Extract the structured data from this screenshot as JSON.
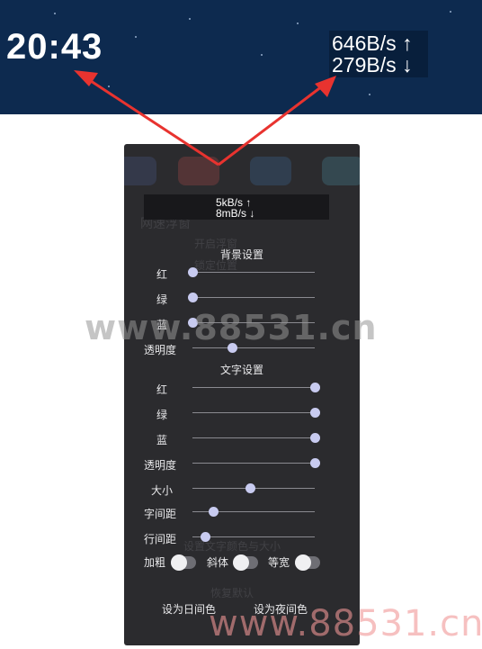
{
  "status_bar": {
    "clock": "20:43",
    "upload_speed": "646B/s ↑",
    "download_speed": "279B/s ↓"
  },
  "preview": {
    "upload": "5kB/s ↑",
    "download": "8mB/s ↓"
  },
  "background_settings": {
    "title": "背景设置",
    "sliders": [
      {
        "label": "红",
        "value": 0.0
      },
      {
        "label": "绿",
        "value": 0.0
      },
      {
        "label": "蓝",
        "value": 0.0
      },
      {
        "label": "透明度",
        "value": 0.32
      }
    ]
  },
  "text_settings": {
    "title": "文字设置",
    "sliders": [
      {
        "label": "红",
        "value": 1.0
      },
      {
        "label": "绿",
        "value": 1.0
      },
      {
        "label": "蓝",
        "value": 1.0
      },
      {
        "label": "透明度",
        "value": 1.0
      },
      {
        "label": "大小",
        "value": 0.47
      },
      {
        "label": "字间距",
        "value": 0.17
      },
      {
        "label": "行间距",
        "value": 0.1
      }
    ]
  },
  "toggles": [
    {
      "label": "加粗",
      "on": false
    },
    {
      "label": "斜体",
      "on": false
    },
    {
      "label": "等宽",
      "on": false
    }
  ],
  "buttons": {
    "day_color": "设为日间色",
    "night_color": "设为夜间色"
  },
  "background_ghost_text": [
    "网速浮窗",
    "开启浮窗",
    "锁定位置",
    "设置文字颜色与大小",
    "恢复默认"
  ],
  "watermark": {
    "middle": "www.88531.cn",
    "bottom": "www.88531.cn"
  },
  "colors": {
    "status_bar_bg": "#0d2a4f",
    "panel_bg": "#2b2b2e",
    "arrow": "#e8332f",
    "slider_thumb": "#c8cbf0"
  }
}
